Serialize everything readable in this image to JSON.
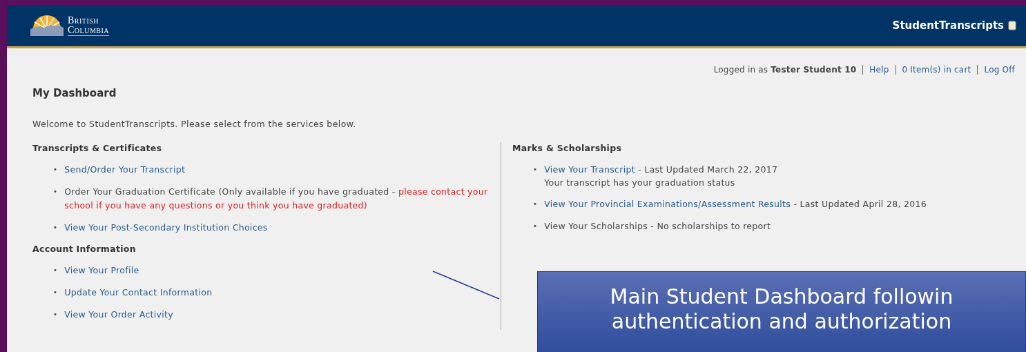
{
  "header": {
    "logo_line1": "British",
    "logo_line2": "Columbia",
    "app_title": "StudentTranscripts"
  },
  "user_bar": {
    "prefix": "Logged in as",
    "user": "Tester Student 10",
    "links": [
      "Help",
      "0 Item(s) in cart",
      "Log Off"
    ]
  },
  "page_title": "My Dashboard",
  "welcome": "Welcome to StudentTranscripts. Please select from the services below.",
  "left_sections": [
    {
      "heading": "Transcripts & Certificates",
      "bullet": "•",
      "items": [
        [
          {
            "kind": "link",
            "text": "Send/Order Your Transcript"
          }
        ],
        [
          {
            "kind": "text",
            "text": "Order Your Graduation Certificate (Only available if you have graduated - "
          },
          {
            "kind": "warning",
            "text": "please contact your school if you have any questions or you think you have graduated)"
          }
        ],
        [
          {
            "kind": "link",
            "text": "View Your Post-Secondary Institution Choices"
          }
        ]
      ]
    },
    {
      "heading": "Account Information",
      "bullet": "•",
      "items": [
        [
          {
            "kind": "link",
            "text": "View Your Profile"
          }
        ],
        [
          {
            "kind": "link",
            "text": "Update Your Contact Information"
          }
        ],
        [
          {
            "kind": "link",
            "text": "View Your Order Activity"
          }
        ]
      ]
    }
  ],
  "right_sections": [
    {
      "heading": "Marks & Scholarships",
      "bullet": "•",
      "items": [
        [
          {
            "kind": "link",
            "text": "View Your Transcript"
          },
          {
            "kind": "text",
            "text": " - Last Updated March 22, 2017"
          },
          {
            "kind": "note",
            "text": "Your transcript has your graduation status"
          }
        ],
        [
          {
            "kind": "link",
            "text": "View Your Provincial Examinations/Assessment Results"
          },
          {
            "kind": "text",
            "text": " - Last Updated April 28, 2016"
          }
        ],
        [
          {
            "kind": "text",
            "text": "View Your Scholarships - No scholarships to report"
          }
        ]
      ]
    }
  ],
  "callout": {
    "lines": [
      "Main Student Dashboard followin",
      "authentication and authorization"
    ]
  }
}
